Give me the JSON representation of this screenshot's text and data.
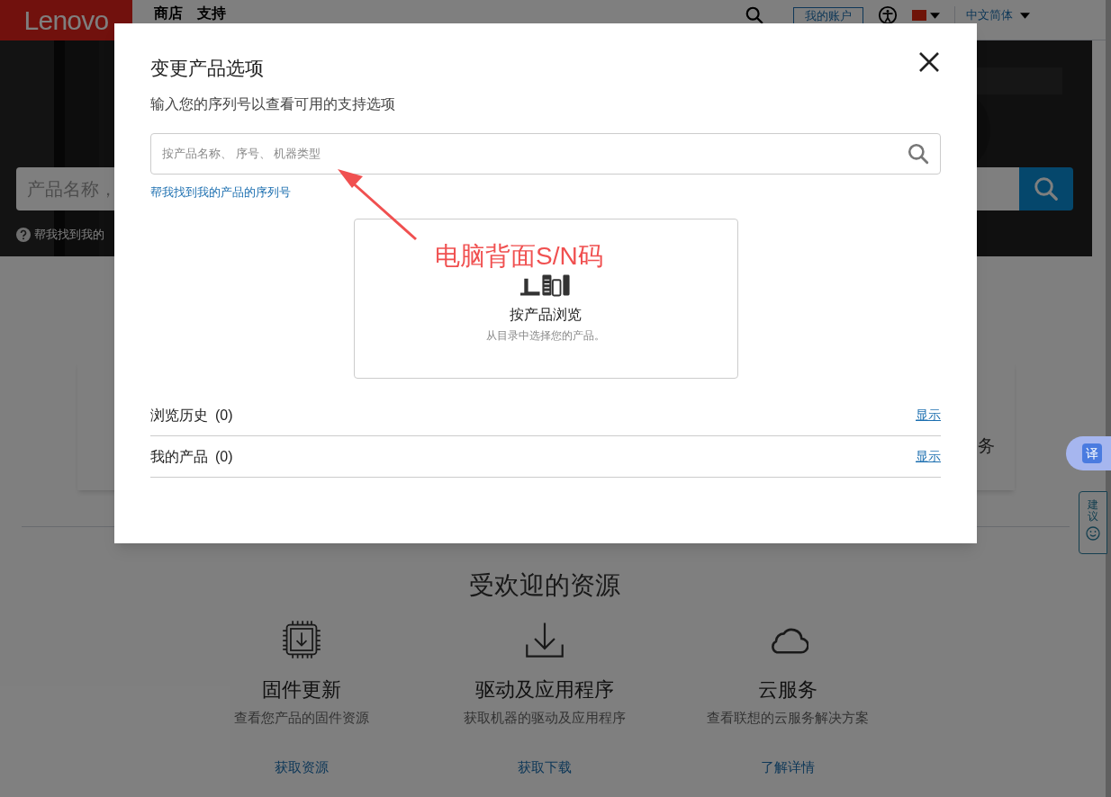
{
  "header": {
    "logo": "Lenovo",
    "nav": [
      "商店",
      "支持"
    ],
    "account_button": "我的账户",
    "language": "中文简体"
  },
  "hero": {
    "search_placeholder": "产品名称，",
    "help_link": "帮我找到我的"
  },
  "card": {
    "text_fragment": "务"
  },
  "resources": {
    "title": "受欢迎的资源",
    "items": [
      {
        "kind": "chip",
        "title": "固件更新",
        "description": "查看您产品的固件资源",
        "link": "获取资源"
      },
      {
        "kind": "download",
        "title": "驱动及应用程序",
        "description": "获取机器的驱动及应用程序",
        "link": "获取下载"
      },
      {
        "kind": "cloud",
        "title": "云服务",
        "description": "查看联想的云服务解决方案",
        "link": "了解详情"
      }
    ]
  },
  "side_widgets": {
    "translate": "译",
    "feedback": "建议"
  },
  "modal": {
    "title": "变更产品选项",
    "subtitle": "输入您的序列号以查看可用的支持选项",
    "search_placeholder": "按产品名称、 序号、 机器类型",
    "help_link": "帮我找到我的产品的序列号",
    "browse_card": {
      "title": "按产品浏览",
      "description": "从目录中选择您的产品。"
    },
    "rows": [
      {
        "label": "浏览历史",
        "count": "(0)",
        "action": "显示"
      },
      {
        "label": "我的产品",
        "count": "(0)",
        "action": "显示"
      }
    ]
  },
  "annotation": {
    "text": "电脑背面S/N码"
  }
}
